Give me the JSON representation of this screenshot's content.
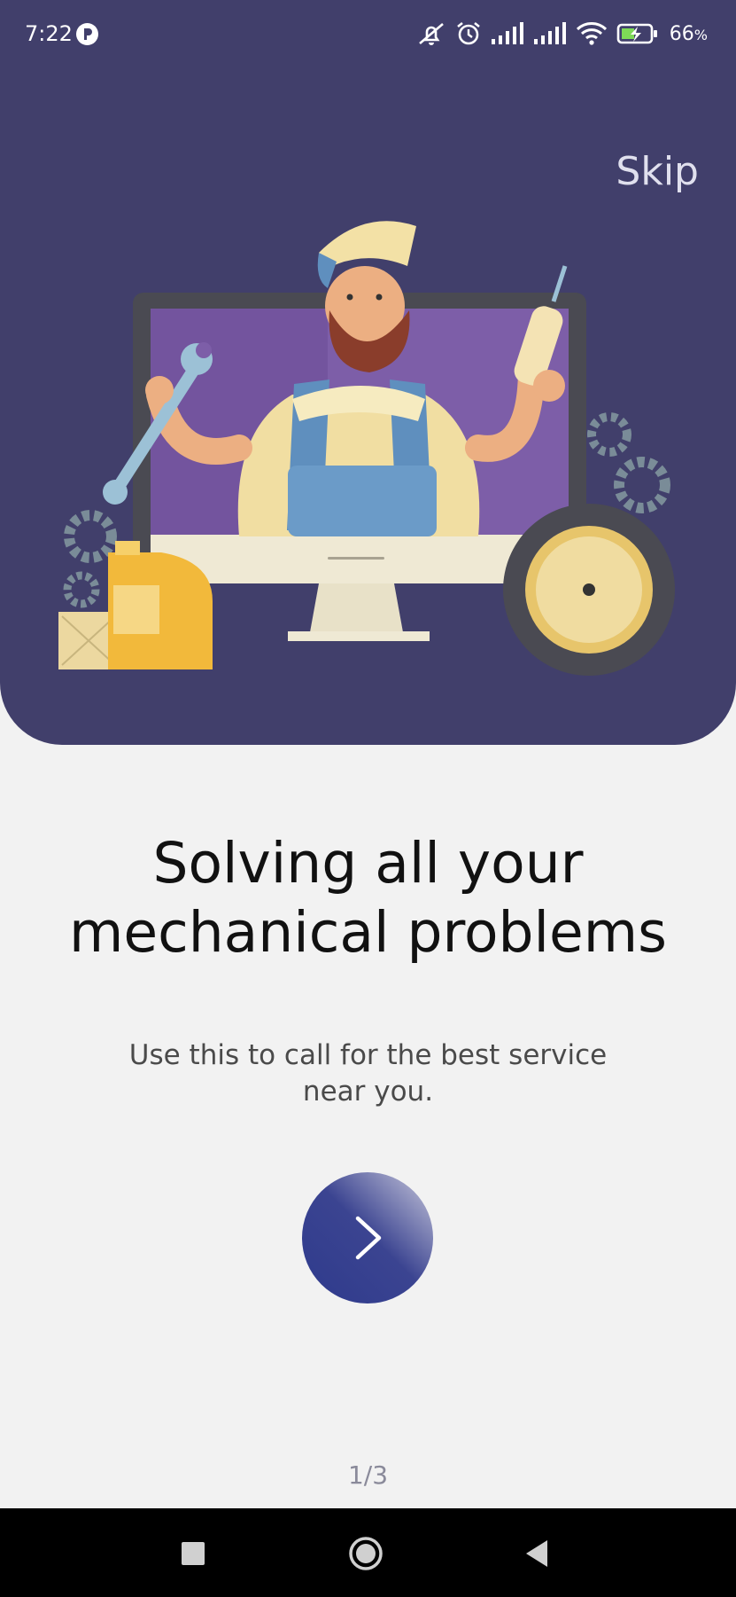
{
  "status_bar": {
    "time": "7:22",
    "battery_percent": "66",
    "battery_unit": "%",
    "icons": [
      "app-notification-icon",
      "silent-icon",
      "alarm-icon",
      "signal-icon",
      "signal-icon",
      "wifi-icon",
      "battery-charging-icon"
    ]
  },
  "onboarding": {
    "skip_label": "Skip",
    "title_line1": "Solving all your",
    "title_line2": "mechanical problems",
    "subtitle_line1": "Use this to call for the best service",
    "subtitle_line2": "near you.",
    "next_icon": "chevron-right-icon",
    "page_indicator": "1/3"
  },
  "colors": {
    "hero_background": "#413f6b",
    "page_background": "#f2f2f2",
    "button_gradient_start": "#2e3a8c",
    "button_gradient_end": "#c9c9dc"
  },
  "nav_bar": {
    "icons": [
      "recents-square-icon",
      "home-circle-icon",
      "back-triangle-icon"
    ]
  }
}
